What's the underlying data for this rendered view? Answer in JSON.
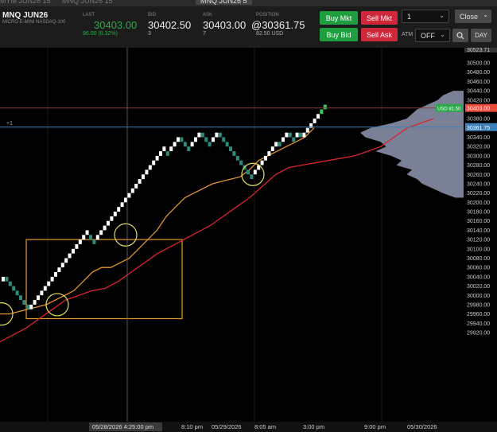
{
  "tabs": [
    {
      "label": "MYM JUN26 15",
      "x": 0
    },
    {
      "label": "MNQ JUN26 15",
      "x": 78
    },
    {
      "label": "MNQ JUN26 5",
      "x": 246,
      "active": true
    }
  ],
  "header": {
    "symbol": "MNQ JUN26",
    "description": "MICRO E-MINI NASDAQ-100",
    "last_label": "LAST",
    "last": "30403.00",
    "last_change": "96.00 (0.32%)",
    "bid_label": "BID",
    "bid": "30402.50",
    "bid_size": "3",
    "ask_label": "ASK",
    "ask": "30403.00",
    "ask_size": "7",
    "position_label": "POSITION",
    "position": "@30361.75",
    "position_pnl": "82.50 USD",
    "buy_mkt": "Buy Mkt",
    "sell_mkt": "Sell Mkt",
    "buy_bid": "Buy Bid",
    "sell_ask": "Sell Ask",
    "quantity": "1",
    "close": "Close",
    "atm_label": "ATM",
    "atm_value": "OFF",
    "day": "DAY"
  },
  "colors": {
    "up_brick": "#ffffff",
    "down_brick": "#2e8b7a",
    "orange_line": "#e0962d",
    "red_line": "#d8262e",
    "last_line": "#8a3a3a",
    "position_line": "#3d7fb8",
    "profile": "#8f98b0",
    "last_tag": "#e84b3c",
    "pnl_tag": "#2ea84a",
    "position_tag": "#3d7fb8",
    "highlight_box": "#e0962d",
    "highlight_circle": "#e3e063"
  },
  "price_axis": {
    "top_label": "30523.71",
    "ticks": [
      "30500.00",
      "30480.00",
      "30460.00",
      "30440.00",
      "30420.00",
      "30400.00",
      "30380.00",
      "30360.00",
      "30340.00",
      "30320.00",
      "30300.00",
      "30280.00",
      "30260.00",
      "30240.00",
      "30220.00",
      "30200.00",
      "30180.00",
      "30160.00",
      "30140.00",
      "30120.00",
      "30100.00",
      "30080.00",
      "30060.00",
      "30040.00",
      "30020.00",
      "30000.00",
      "29980.00",
      "29960.00",
      "29940.00",
      "29920.00"
    ],
    "last_tag": "30403.00",
    "pnl_tag": "USD 81.50",
    "position_tag": "30361.75",
    "position_qty": "+1"
  },
  "time_axis": {
    "crosshair_label": "05/28/2026 4:25:00 pm",
    "labels": [
      "8:10 pm",
      "05/29/2026",
      "8:05 am",
      "3:00 pm",
      "9:00 pm",
      "05/30/2026"
    ]
  },
  "chart_data": {
    "type": "renko",
    "price_range": [
      29920,
      30523.71
    ],
    "last_price": 30403.0,
    "position_price": 30361.75,
    "crosshair_price_index": 26,
    "bricks": [
      {
        "d": "up",
        "p": 30040
      },
      {
        "d": "down",
        "p": 30030
      },
      {
        "d": "down",
        "p": 30020
      },
      {
        "d": "down",
        "p": 30010
      },
      {
        "d": "down",
        "p": 30000
      },
      {
        "d": "down",
        "p": 29990
      },
      {
        "d": "down",
        "p": 29980
      },
      {
        "d": "down",
        "p": 29970
      },
      {
        "d": "up",
        "p": 29980
      },
      {
        "d": "up",
        "p": 29990
      },
      {
        "d": "up",
        "p": 30000
      },
      {
        "d": "up",
        "p": 30010
      },
      {
        "d": "up",
        "p": 30020
      },
      {
        "d": "up",
        "p": 30030
      },
      {
        "d": "up",
        "p": 30040
      },
      {
        "d": "up",
        "p": 30050
      },
      {
        "d": "up",
        "p": 30060
      },
      {
        "d": "up",
        "p": 30070
      },
      {
        "d": "up",
        "p": 30080
      },
      {
        "d": "up",
        "p": 30090
      },
      {
        "d": "up",
        "p": 30100
      },
      {
        "d": "up",
        "p": 30110
      },
      {
        "d": "up",
        "p": 30120
      },
      {
        "d": "up",
        "p": 30130
      },
      {
        "d": "up",
        "p": 30140
      },
      {
        "d": "down",
        "p": 30120
      },
      {
        "d": "down",
        "p": 30110
      },
      {
        "d": "up",
        "p": 30130
      },
      {
        "d": "up",
        "p": 30140
      },
      {
        "d": "up",
        "p": 30150
      },
      {
        "d": "up",
        "p": 30160
      },
      {
        "d": "up",
        "p": 30170
      },
      {
        "d": "up",
        "p": 30180
      },
      {
        "d": "up",
        "p": 30190
      },
      {
        "d": "up",
        "p": 30200
      },
      {
        "d": "up",
        "p": 30210
      },
      {
        "d": "up",
        "p": 30220
      },
      {
        "d": "up",
        "p": 30230
      },
      {
        "d": "up",
        "p": 30240
      },
      {
        "d": "up",
        "p": 30250
      },
      {
        "d": "up",
        "p": 30260
      },
      {
        "d": "up",
        "p": 30270
      },
      {
        "d": "up",
        "p": 30280
      },
      {
        "d": "up",
        "p": 30290
      },
      {
        "d": "up",
        "p": 30300
      },
      {
        "d": "up",
        "p": 30310
      },
      {
        "d": "up",
        "p": 30320
      },
      {
        "d": "down",
        "p": 30300
      },
      {
        "d": "up",
        "p": 30320
      },
      {
        "d": "up",
        "p": 30330
      },
      {
        "d": "up",
        "p": 30340
      },
      {
        "d": "down",
        "p": 30330
      },
      {
        "d": "down",
        "p": 30320
      },
      {
        "d": "down",
        "p": 30310
      },
      {
        "d": "up",
        "p": 30330
      },
      {
        "d": "up",
        "p": 30340
      },
      {
        "d": "up",
        "p": 30350
      },
      {
        "d": "down",
        "p": 30340
      },
      {
        "d": "down",
        "p": 30330
      },
      {
        "d": "down",
        "p": 30320
      },
      {
        "d": "up",
        "p": 30340
      },
      {
        "d": "up",
        "p": 30350
      },
      {
        "d": "down",
        "p": 30340
      },
      {
        "d": "down",
        "p": 30330
      },
      {
        "d": "down",
        "p": 30320
      },
      {
        "d": "down",
        "p": 30310
      },
      {
        "d": "down",
        "p": 30300
      },
      {
        "d": "down",
        "p": 30290
      },
      {
        "d": "down",
        "p": 30280
      },
      {
        "d": "down",
        "p": 30270
      },
      {
        "d": "down",
        "p": 30260
      },
      {
        "d": "down",
        "p": 30250
      },
      {
        "d": "up",
        "p": 30270
      },
      {
        "d": "up",
        "p": 30280
      },
      {
        "d": "up",
        "p": 30290
      },
      {
        "d": "up",
        "p": 30300
      },
      {
        "d": "up",
        "p": 30310
      },
      {
        "d": "up",
        "p": 30320
      },
      {
        "d": "up",
        "p": 30330
      },
      {
        "d": "down",
        "p": 30320
      },
      {
        "d": "up",
        "p": 30340
      },
      {
        "d": "up",
        "p": 30350
      },
      {
        "d": "down",
        "p": 30340
      },
      {
        "d": "down",
        "p": 30330
      },
      {
        "d": "up",
        "p": 30350
      },
      {
        "d": "down",
        "p": 30340
      },
      {
        "d": "up",
        "p": 30350
      },
      {
        "d": "up",
        "p": 30360
      },
      {
        "d": "up",
        "p": 30370
      },
      {
        "d": "up",
        "p": 30380
      },
      {
        "d": "up",
        "p": 30390
      },
      {
        "d": "up",
        "p": 30400
      },
      {
        "d": "up",
        "p": 30410
      }
    ],
    "series": [
      {
        "role": "orange line",
        "values": [
          29960,
          29960,
          29965,
          29970,
          29975,
          29980,
          29990,
          30000,
          30010,
          30030,
          30050,
          30060,
          30060,
          30070,
          30080,
          30100,
          30120,
          30140,
          30170,
          30190,
          30210,
          30220,
          30230,
          30240,
          30245,
          30250,
          30255,
          30270,
          30290,
          30300,
          30310,
          30320,
          30330,
          30340,
          30360
        ]
      },
      {
        "role": "red line",
        "values": [
          29900,
          29915,
          29930,
          29950,
          29970,
          29990,
          30000,
          30010,
          30015,
          30030,
          30050,
          30070,
          30090,
          30105,
          30120,
          30135,
          30150,
          30170,
          30190,
          30210,
          30235,
          30260,
          30275,
          30280,
          30285,
          30290,
          30295,
          30300,
          30310,
          30320,
          30340,
          30360,
          30370,
          30380
        ]
      }
    ],
    "volume_profile": [
      {
        "p": 30440,
        "v": 0.1
      },
      {
        "p": 30430,
        "v": 0.2
      },
      {
        "p": 30420,
        "v": 0.25
      },
      {
        "p": 30410,
        "v": 0.35
      },
      {
        "p": 30400,
        "v": 0.45
      },
      {
        "p": 30390,
        "v": 0.5
      },
      {
        "p": 30380,
        "v": 0.55
      },
      {
        "p": 30370,
        "v": 0.7
      },
      {
        "p": 30360,
        "v": 0.9
      },
      {
        "p": 30350,
        "v": 1.0
      },
      {
        "p": 30340,
        "v": 0.95
      },
      {
        "p": 30330,
        "v": 0.8
      },
      {
        "p": 30320,
        "v": 0.75
      },
      {
        "p": 30310,
        "v": 0.85
      },
      {
        "p": 30300,
        "v": 0.7
      },
      {
        "p": 30290,
        "v": 0.6
      },
      {
        "p": 30280,
        "v": 0.65
      },
      {
        "p": 30270,
        "v": 0.5
      },
      {
        "p": 30260,
        "v": 0.55
      },
      {
        "p": 30250,
        "v": 0.45
      },
      {
        "p": 30240,
        "v": 0.4
      },
      {
        "p": 30230,
        "v": 0.3
      },
      {
        "p": 30220,
        "v": 0.2
      },
      {
        "p": 30210,
        "v": 0.08
      }
    ]
  }
}
